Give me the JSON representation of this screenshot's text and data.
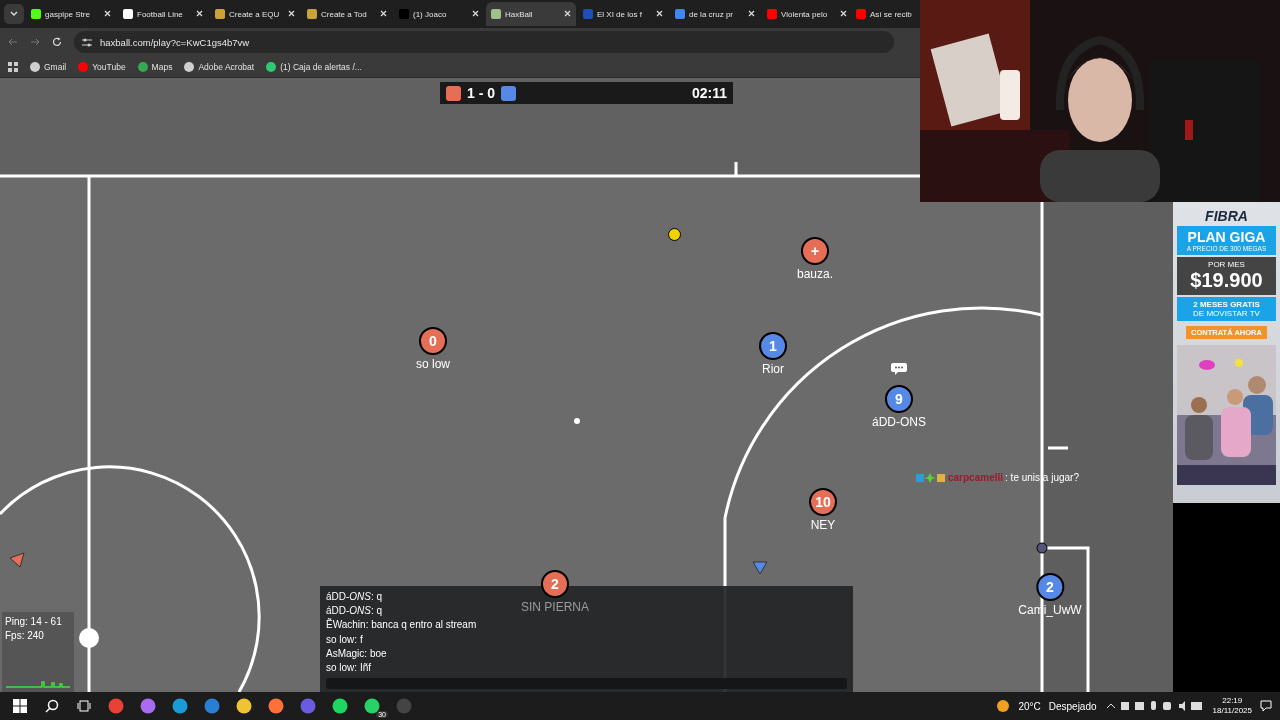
{
  "browser": {
    "tabs": [
      {
        "title": "gaspipe Stre",
        "color": "#53fc18",
        "selected": false
      },
      {
        "title": "Football Line",
        "color": "#ffffff",
        "selected": false
      },
      {
        "title": "Create a EQU",
        "color": "#c9a23a",
        "selected": false
      },
      {
        "title": "Create a Tod",
        "color": "#c9a23a",
        "selected": false
      },
      {
        "title": "(1) Joaco",
        "color": "#000000",
        "selected": false
      },
      {
        "title": "HaxBall",
        "color": "#9fc08a",
        "selected": true
      },
      {
        "title": "El XI de los f",
        "color": "#1d4fb5",
        "selected": false
      },
      {
        "title": "de la cruz pr",
        "color": "#4285f4",
        "selected": false
      },
      {
        "title": "Violenta pelo",
        "color": "#ff0000",
        "selected": false
      },
      {
        "title": "Así se recib",
        "color": "#ff0000",
        "selected": false
      }
    ],
    "address": "haxball.com/play?c=KwC1gs4b7vw",
    "bookmarks": [
      {
        "label": "Gmail",
        "color": "#cfcfcf"
      },
      {
        "label": "YouTube",
        "color": "#ff0000"
      },
      {
        "label": "Maps",
        "color": "#34a853"
      },
      {
        "label": "Adobe Acrobat",
        "color": "#cfcfcf"
      },
      {
        "label": "(1) Caja de alertas /...",
        "color": "#2ecc71"
      }
    ]
  },
  "game": {
    "score": "1 - 0",
    "timer": "02:11",
    "players": [
      {
        "number": "+",
        "name": "bauza.",
        "color": "#e56e56",
        "typing": false
      },
      {
        "number": "0",
        "name": "so low",
        "color": "#e56e56",
        "typing": false
      },
      {
        "number": "1",
        "name": "Rior",
        "color": "#5689e5",
        "typing": false
      },
      {
        "number": "9",
        "name": "áDD-ONS",
        "color": "#5689e5",
        "typing": true
      },
      {
        "number": "10",
        "name": "NEY",
        "color": "#e56e56",
        "typing": false
      },
      {
        "number": "2",
        "name": "SIN  PIERNA",
        "color": "#e56e56",
        "typing": false
      },
      {
        "number": "2",
        "name": "Cami_UwW",
        "color": "#5689e5",
        "typing": false
      }
    ],
    "announcement": {
      "name": "carpcamelli",
      "text": ": te unis a jugar?"
    },
    "stats": {
      "ping": "Ping: 14 - 61",
      "fps": "Fps: 240"
    },
    "chat": [
      "áDD-*ONS*: q",
      "áDD-*ONS*: q",
      "ẼWachin: banca q entro al stream",
      "so low: f",
      "AsMagic: boe",
      "so low: Iñf"
    ]
  },
  "ad": {
    "product": "FIBRA",
    "plan": "PLAN GIGA",
    "plan_note": "A PRECIO DE 300 MEGAS",
    "period": "POR MES",
    "price": "$19.900",
    "promo": "2 MESES GRATIS",
    "promo_note": "DE MOVISTAR TV",
    "cta": "CONTRATÁ AHORA"
  },
  "taskbar": {
    "badge": "30",
    "temperature": "20°C",
    "weather": "Despejado",
    "time": "22:19",
    "date": "18/11/2025"
  }
}
